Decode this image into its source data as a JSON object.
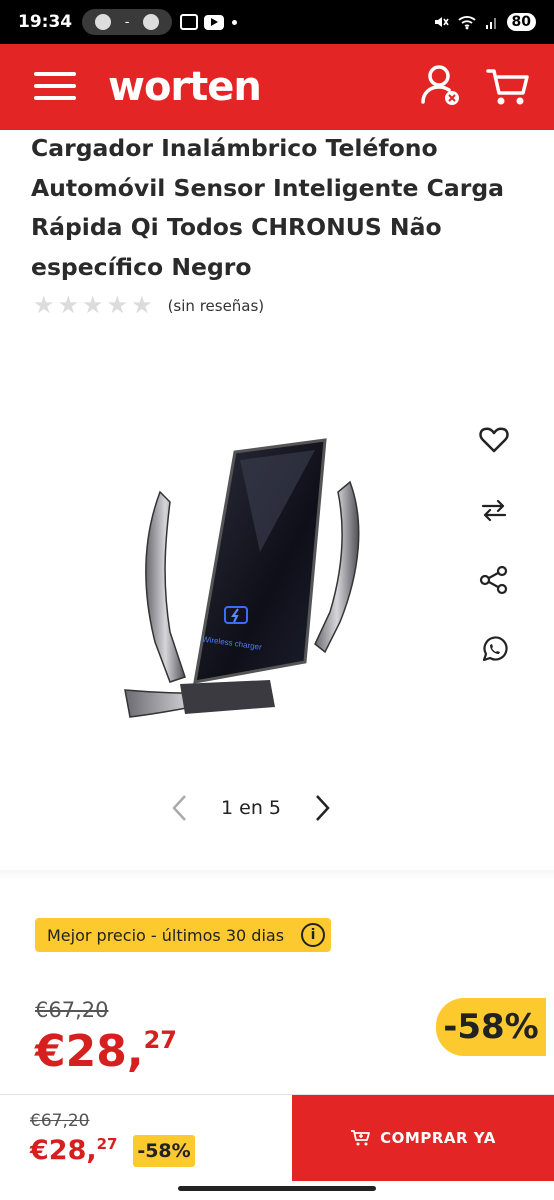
{
  "status_bar": {
    "time": "19:34",
    "pill_text": "-",
    "battery": "80"
  },
  "header": {
    "logo": "worten"
  },
  "product": {
    "title": "Cargador Inalámbrico Teléfono Automóvil Sensor Inteligente Carga Rápida Qi Todos CHRONUS Não específico Negro",
    "rating_stars": 0,
    "reviews_text": "(sin reseñas)",
    "image_label": "Wireless charger"
  },
  "gallery": {
    "pager_text": "1 en 5"
  },
  "pricing": {
    "best_price_badge": "Mejor precio - últimos 30 dias",
    "old_price": "€67,20",
    "new_price_main": "€28,",
    "new_price_cents": "27",
    "discount": "-58%"
  },
  "bottom_bar": {
    "old_price": "€67,20",
    "new_price_main": "€28,",
    "new_price_cents": "27",
    "discount": "-58%",
    "buy_label": "COMPRAR YA"
  },
  "colors": {
    "brand_red": "#e32526",
    "price_red": "#d6201f",
    "badge_yellow": "#fcc92f"
  }
}
